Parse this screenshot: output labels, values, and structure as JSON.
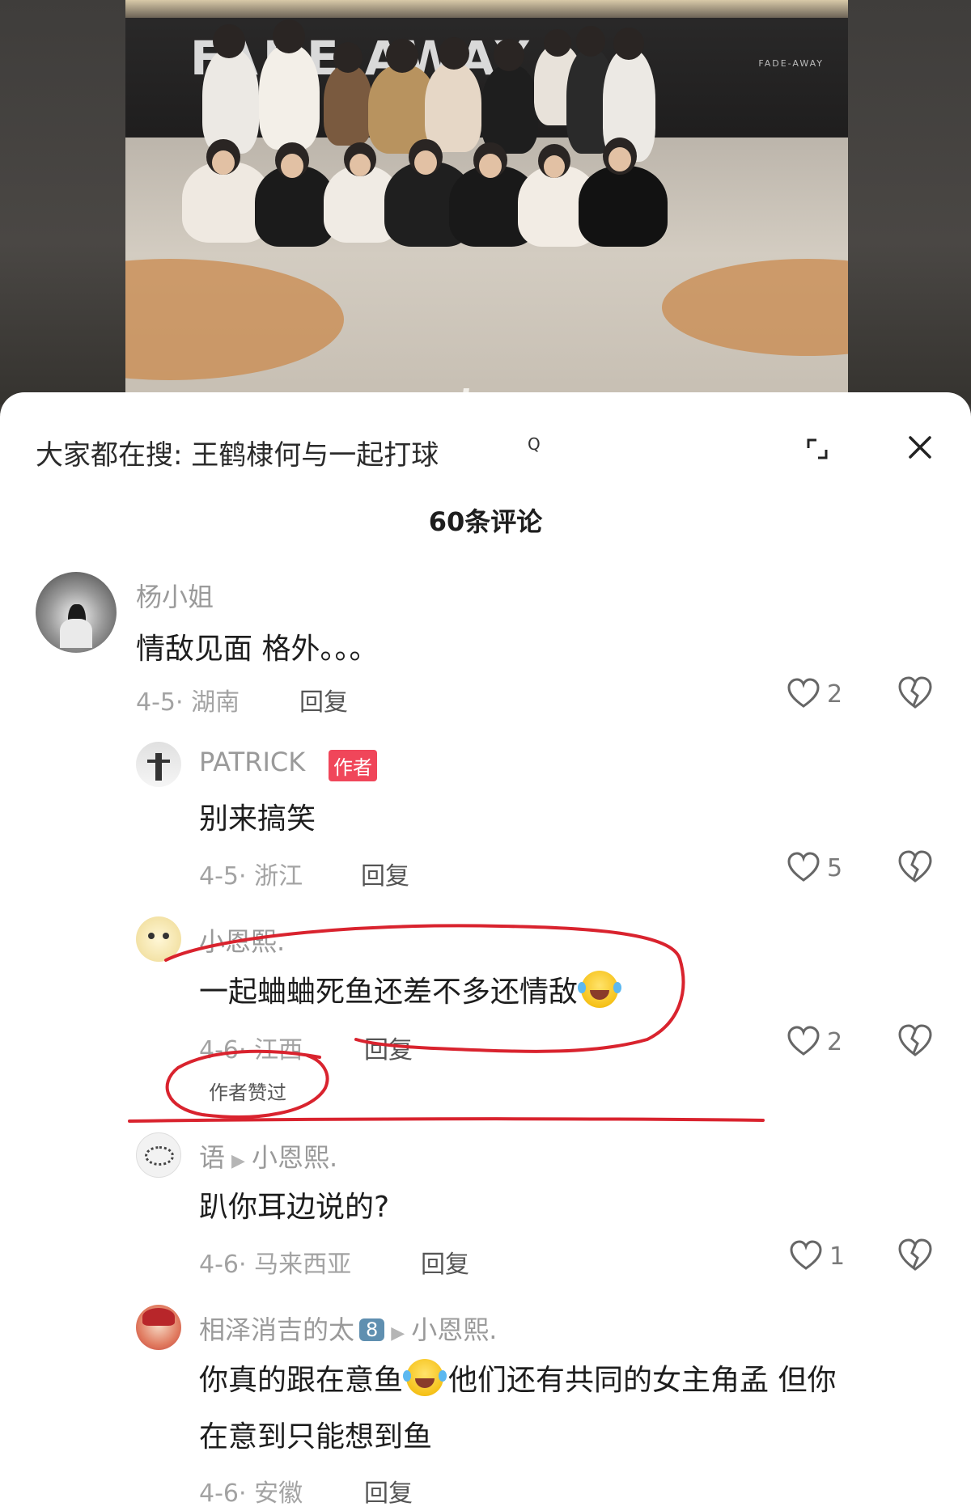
{
  "video": {
    "wall_logo": "FADE  AWAY",
    "wall_logo_small": "FADE-AWAY"
  },
  "sheet": {
    "search_hint": "大家都在搜: 王鹤棣何与一起打球",
    "search_glyph": "Q",
    "expand_icon": "expand-icon",
    "close_icon": "close-icon",
    "comment_count": "60条评论"
  },
  "comments": [
    {
      "author": "杨小姐",
      "body": "情敌见面 格外。。。",
      "date_location": "4-5· 湖南",
      "reply_label": "回复",
      "likes": "2"
    },
    {
      "author": "PATRICK",
      "author_tag": "作者",
      "body": "别来搞笑",
      "date_location": "4-5· 浙江",
      "reply_label": "回复",
      "likes": "5"
    },
    {
      "author": "小恩熙.",
      "body": "一起蛐蛐死鱼还差不多还情敌",
      "date_location": "4-6· 江西",
      "reply_label": "回复",
      "liked_by_author": "作者赞过",
      "likes": "2"
    },
    {
      "author": "语",
      "reply_to": "小恩熙.",
      "body": "趴你耳边说的?",
      "date_location": "4-6· 马来西亚",
      "reply_label": "回复",
      "likes": "1"
    },
    {
      "author": "相泽消吉的太",
      "level": "8",
      "reply_to": "小恩熙.",
      "body_line1_a": "你真的跟在意鱼",
      "body_line1_b": "他们还有共同的女主角孟 但你",
      "body_line2": "在意到只能想到鱼",
      "date_location": "4-6· 安徽",
      "reply_label": "回复"
    }
  ],
  "colors": {
    "author_tag_bg": "#f0465a",
    "annotation_red": "#d9232e",
    "level_badge": "#5f8fb0"
  }
}
